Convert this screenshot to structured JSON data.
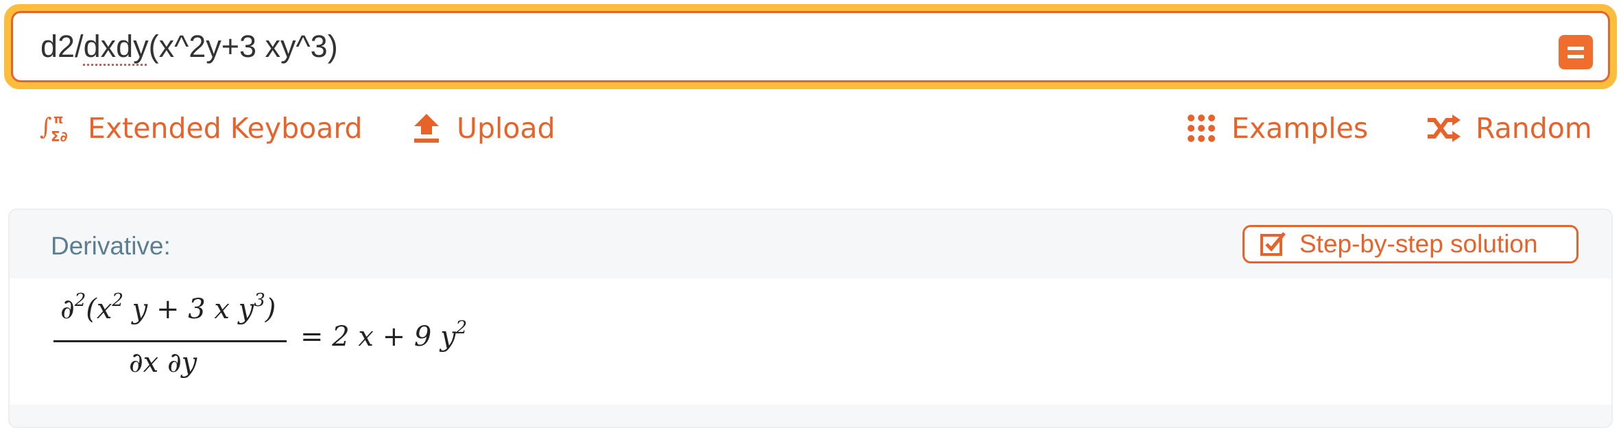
{
  "search": {
    "query_prefix": "d2/",
    "query_flagged": "dxdy",
    "query_suffix": "(x^2y+3 xy^3)"
  },
  "toolbar": {
    "extended_keyboard_label": "Extended Keyboard",
    "upload_label": "Upload",
    "examples_label": "Examples",
    "random_label": "Random"
  },
  "pod": {
    "title": "Derivative:",
    "step_by_step_label": "Step-by-step solution",
    "result": {
      "numerator_open": "∂",
      "numerator_exp": "2",
      "numerator_body": "(x",
      "x_exp": "2",
      "numerator_mid": " y + 3 x y",
      "y_exp": "3",
      "numerator_close": ")",
      "denominator": "∂x ∂y",
      "rhs": "= 2 x + 9 y",
      "rhs_exp": "2"
    }
  },
  "colors": {
    "accent": "#e8632a",
    "focus_ring": "#fbbd3c",
    "pod_title": "#5b7f91"
  },
  "icons": {
    "compute": "equals-icon",
    "extended_keyboard": "math-symbols-icon",
    "upload": "upload-icon",
    "examples": "grid-dots-icon",
    "random": "shuffle-icon",
    "step_by_step": "checkbox-icon"
  }
}
